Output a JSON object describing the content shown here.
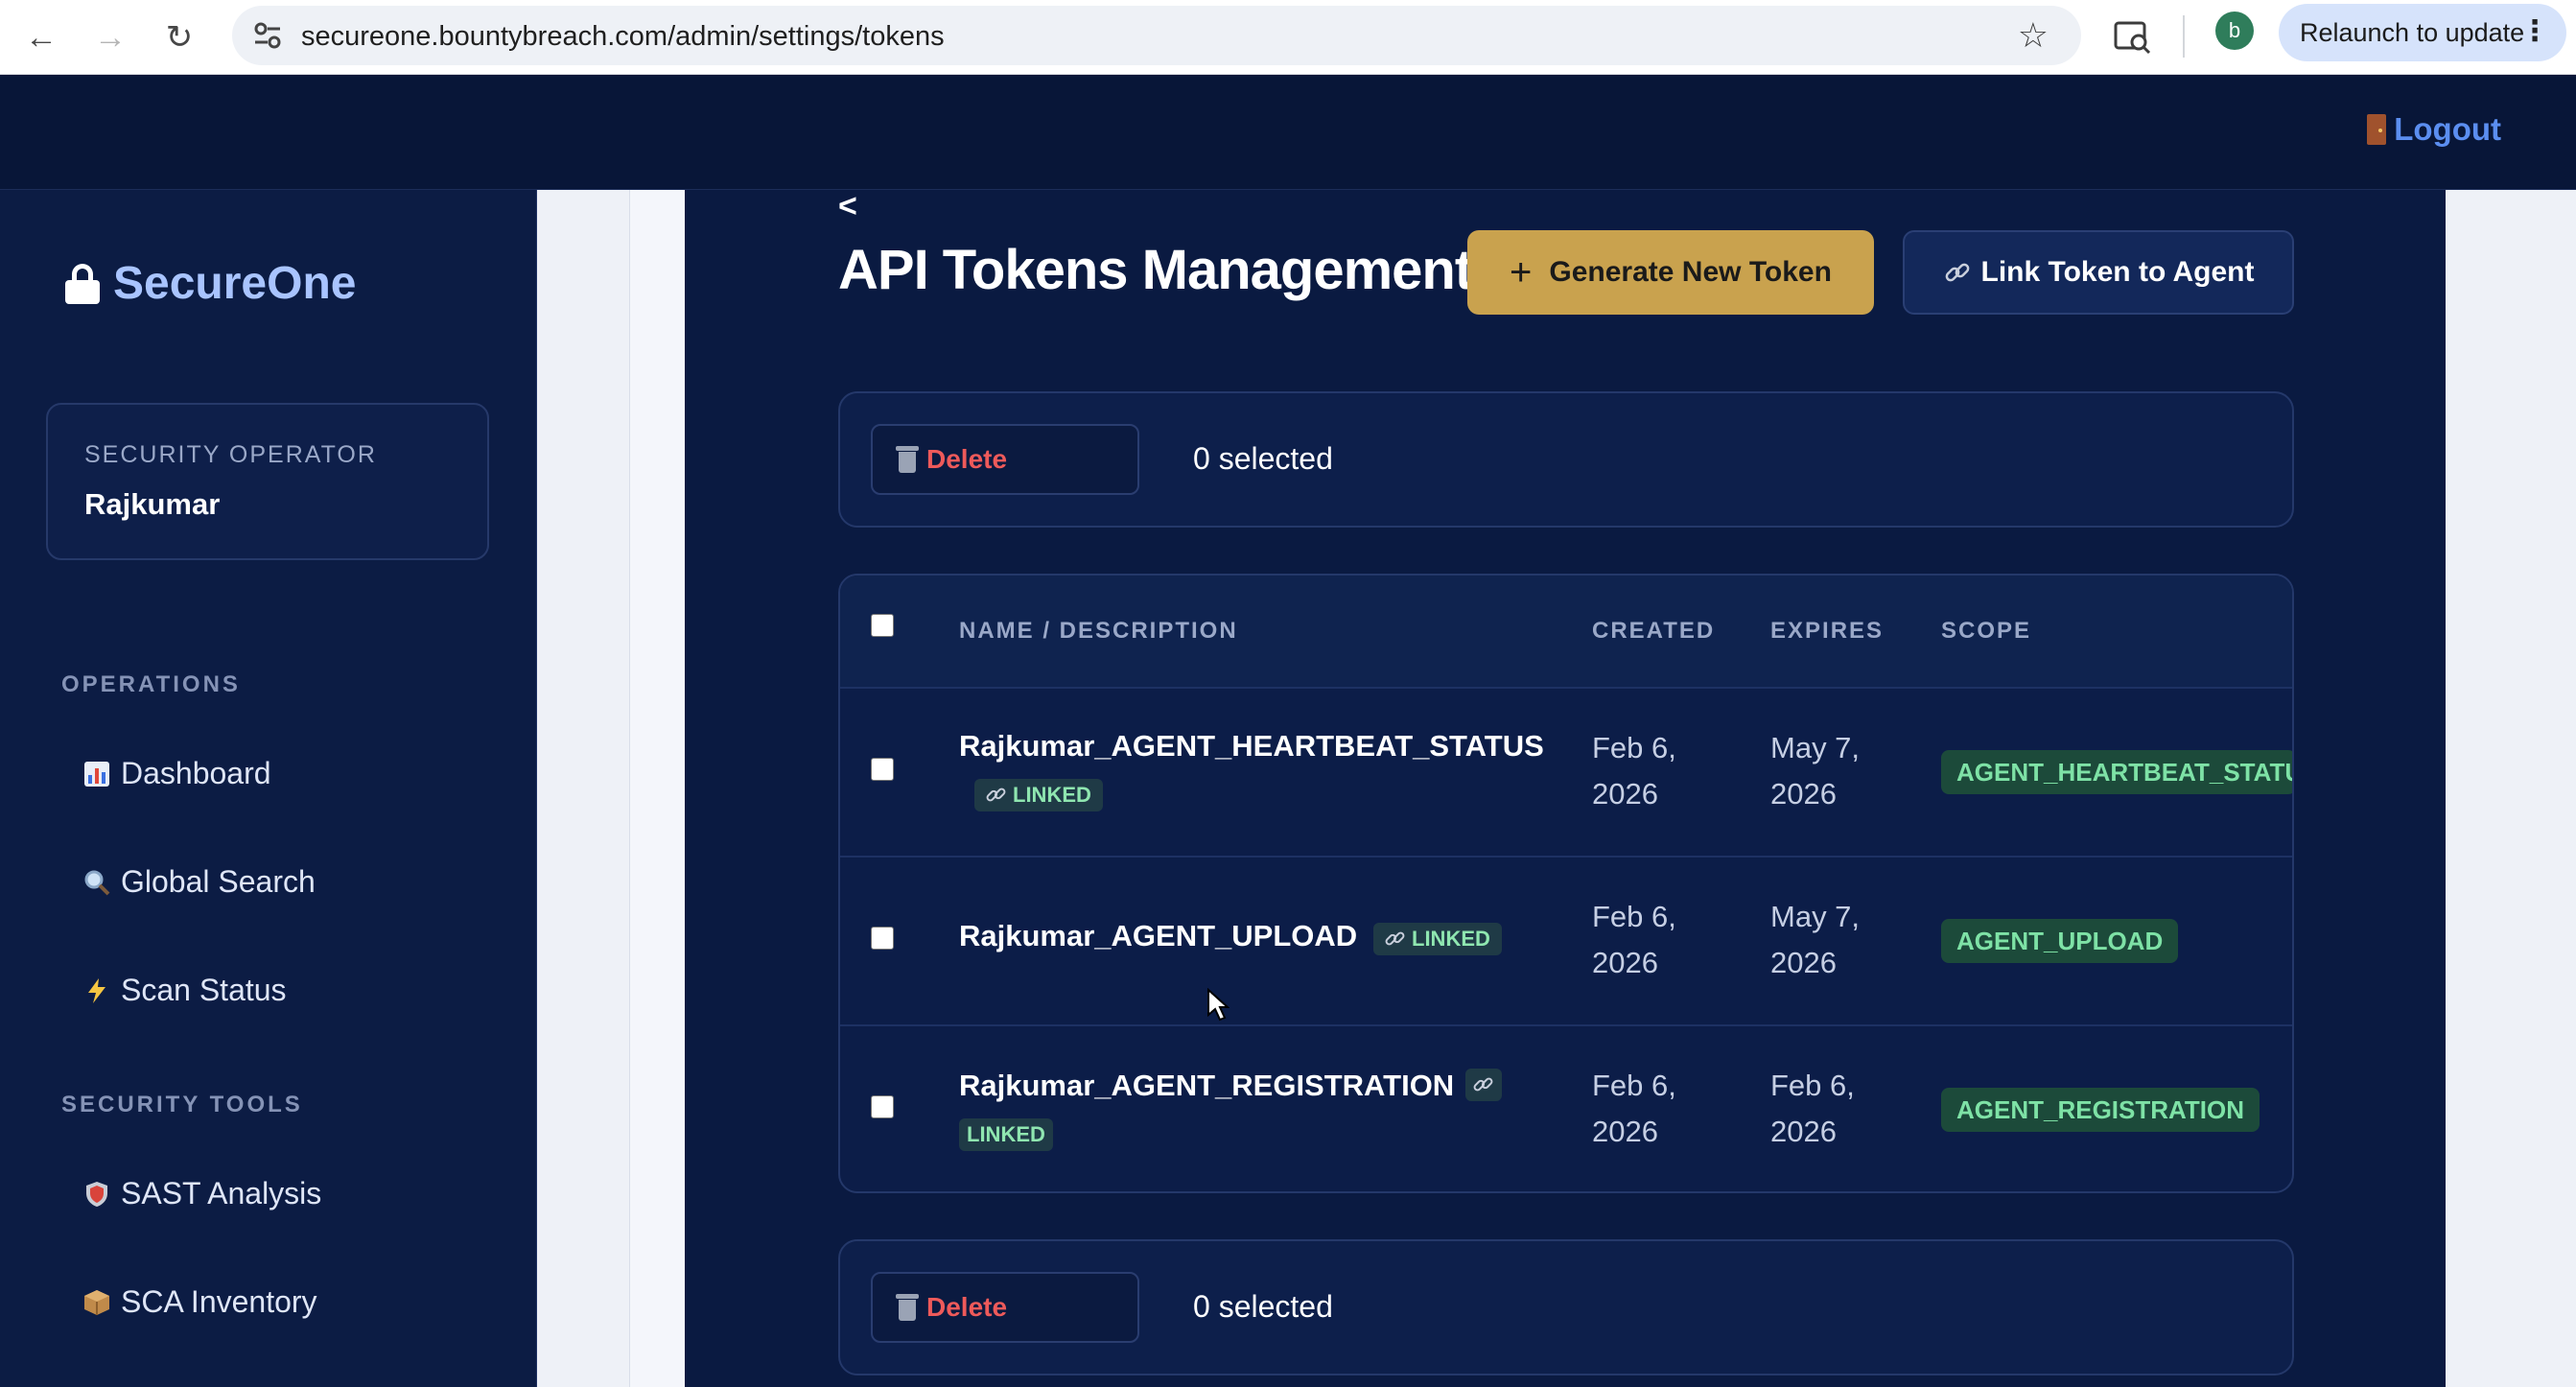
{
  "browser": {
    "url": "secureone.bountybreach.com/admin/settings/tokens",
    "profile_initial": "b",
    "relaunch_label": "Relaunch to update"
  },
  "topbar": {
    "logout_label": "Logout"
  },
  "sidebar": {
    "brand": "SecureOne",
    "user_role": "SECURITY OPERATOR",
    "user_name": "Rajkumar",
    "sections": [
      {
        "label": "OPERATIONS",
        "items": [
          {
            "label": "Dashboard",
            "icon": "bar-chart-icon"
          },
          {
            "label": "Global Search",
            "icon": "magnifier-icon"
          },
          {
            "label": "Scan Status",
            "icon": "lightning-icon"
          }
        ]
      },
      {
        "label": "SECURITY TOOLS",
        "items": [
          {
            "label": "SAST Analysis",
            "icon": "shield-icon"
          },
          {
            "label": "SCA Inventory",
            "icon": "package-icon"
          }
        ]
      }
    ]
  },
  "main": {
    "back_label": "<",
    "title": "API Tokens Management",
    "generate_label": "Generate New Token",
    "link_label": "Link Token to Agent",
    "delete_label": "Delete",
    "selected_text": "0 selected",
    "columns": [
      "NAME / DESCRIPTION",
      "CREATED",
      "EXPIRES",
      "SCOPE"
    ],
    "rows": [
      {
        "name": "Rajkumar_AGENT_HEARTBEAT_STATUS",
        "badge": "LINKED",
        "created_line1": "Feb 6,",
        "created_line2": "2026",
        "expires_line1": "May 7,",
        "expires_line2": "2026",
        "scope": "AGENT_HEARTBEAT_STATU"
      },
      {
        "name": "Rajkumar_AGENT_UPLOAD",
        "badge": "LINKED",
        "created_line1": "Feb 6,",
        "created_line2": "2026",
        "expires_line1": "May 7,",
        "expires_line2": "2026",
        "scope": "AGENT_UPLOAD"
      },
      {
        "name": "Rajkumar_AGENT_REGISTRATION",
        "badge": "LINKED",
        "created_line1": "Feb 6,",
        "created_line2": "2026",
        "expires_line1": "Feb 6,",
        "expires_line2": "2026",
        "scope": "AGENT_REGISTRATION"
      }
    ]
  },
  "colors": {
    "accent_gold": "#c9a24e",
    "navy_bg": "#0a1a41",
    "danger": "#ee5a5a",
    "linked_green": "#8fe6b0",
    "logout_blue": "#5b8ef0"
  }
}
